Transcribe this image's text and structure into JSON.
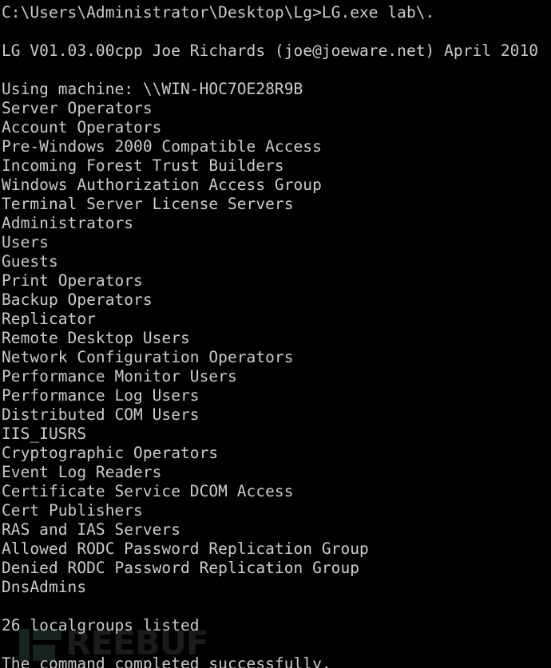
{
  "terminal": {
    "window_kind": "windows-command-prompt",
    "background_color": "#000000",
    "text_color": "#cccccc",
    "prompt_path": "C:\\Users\\Administrator\\Desktop\\Lg>",
    "command": "LG.exe lab\\.",
    "prompt_line": "C:\\Users\\Administrator\\Desktop\\Lg>LG.exe lab\\.",
    "banner": "LG V01.03.00cpp Joe Richards (joe@joeware.net) April 2010",
    "machine_line": "Using machine: \\\\WIN-HOC7OE28R9B",
    "machine_name": "\\\\WIN-HOC7OE28R9B",
    "groups": [
      "Server Operators",
      "Account Operators",
      "Pre-Windows 2000 Compatible Access",
      "Incoming Forest Trust Builders",
      "Windows Authorization Access Group",
      "Terminal Server License Servers",
      "Administrators",
      "Users",
      "Guests",
      "Print Operators",
      "Backup Operators",
      "Replicator",
      "Remote Desktop Users",
      "Network Configuration Operators",
      "Performance Monitor Users",
      "Performance Log Users",
      "Distributed COM Users",
      "IIS_IUSRS",
      "Cryptographic Operators",
      "Event Log Readers",
      "Certificate Service DCOM Access",
      "Cert Publishers",
      "RAS and IAS Servers",
      "Allowed RODC Password Replication Group",
      "Denied RODC Password Replication Group",
      "DnsAdmins"
    ],
    "count_line": "26 localgroups listed",
    "group_count": 26,
    "status_line": "The command completed successfully."
  },
  "watermark": {
    "mark_label": "freebuf-logo-mark",
    "text": "REEBUF",
    "mark_color": "#16241d",
    "text_color": "#1b1b1b"
  }
}
